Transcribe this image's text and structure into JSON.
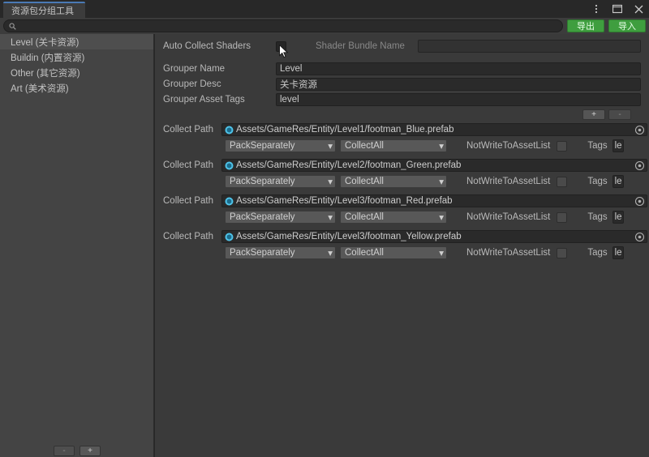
{
  "window": {
    "tab_title": "资源包分组工具",
    "controls": [
      {
        "name": "more-menu",
        "glyph": "⋮"
      },
      {
        "name": "maximize",
        "glyph": "□"
      },
      {
        "name": "close",
        "glyph": "✕"
      }
    ]
  },
  "toolbar": {
    "search_placeholder": "",
    "search_value": "",
    "export_label": "导出",
    "import_label": "导入"
  },
  "sidebar": {
    "items": [
      {
        "label": "Level (关卡资源)",
        "selected": true
      },
      {
        "label": "Buildin (内置资源)",
        "selected": false
      },
      {
        "label": "Other (其它资源)",
        "selected": false
      },
      {
        "label": "Art (美术资源)",
        "selected": false
      }
    ],
    "footer": {
      "remove_label": "-",
      "add_label": "+"
    }
  },
  "main": {
    "auto_collect_shaders_label": "Auto Collect Shaders",
    "auto_collect_shaders_checked": false,
    "shader_bundle_name_label": "Shader Bundle Name",
    "shader_bundle_name_value": "",
    "properties": [
      {
        "label": "Grouper Name",
        "value": "Level"
      },
      {
        "label": "Grouper Desc",
        "value": "关卡资源"
      },
      {
        "label": "Grouper Asset Tags",
        "value": "level"
      }
    ],
    "list_buttons": {
      "add_label": "+",
      "remove_label": "-"
    },
    "collect_path_label": "Collect Path",
    "not_write_label": "NotWriteToAssetList",
    "tags_label": "Tags",
    "collect_paths": [
      {
        "path": "Assets/GameRes/Entity/Level1/footman_Blue.prefab",
        "pack_rule": "PackSeparately",
        "collect_rule": "CollectAll",
        "not_write_to_asset_list": false,
        "tags": "le"
      },
      {
        "path": "Assets/GameRes/Entity/Level2/footman_Green.prefab",
        "pack_rule": "PackSeparately",
        "collect_rule": "CollectAll",
        "not_write_to_asset_list": false,
        "tags": "le"
      },
      {
        "path": "Assets/GameRes/Entity/Level3/footman_Red.prefab",
        "pack_rule": "PackSeparately",
        "collect_rule": "CollectAll",
        "not_write_to_asset_list": false,
        "tags": "le"
      },
      {
        "path": "Assets/GameRes/Entity/Level3/footman_Yellow.prefab",
        "pack_rule": "PackSeparately",
        "collect_rule": "CollectAll",
        "not_write_to_asset_list": false,
        "tags": "le"
      }
    ]
  },
  "colors": {
    "accent_tab": "#4a7ab5",
    "button_green": "#3f9e3f",
    "panel_bg": "#3a3a3a",
    "sidebar_bg": "#444444",
    "prefab_icon": "#4fc3e8"
  }
}
